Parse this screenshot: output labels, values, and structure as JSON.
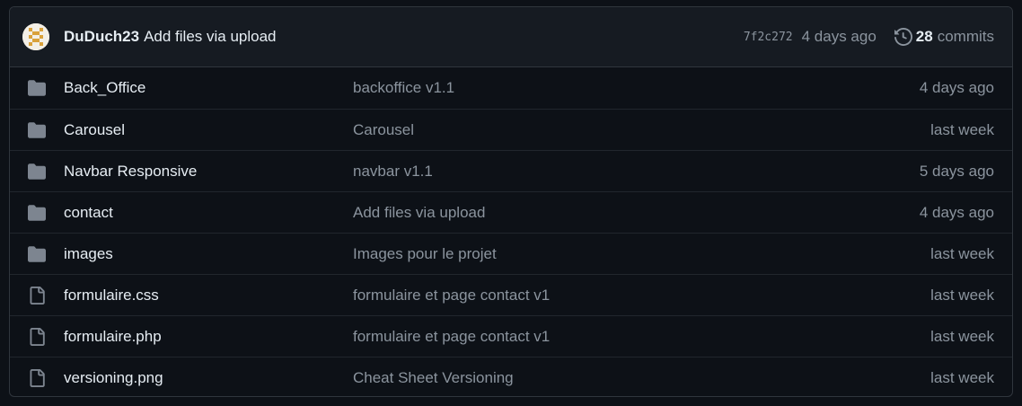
{
  "commit": {
    "author": "DuDuch23",
    "message": "Add files via upload",
    "sha": "7f2c272",
    "time": "4 days ago",
    "commit_count": "28",
    "commits_label": "commits"
  },
  "colors": {
    "background": "#0d1117",
    "header_bg": "#161b22",
    "border": "#30363d",
    "folder_icon": "#7d8590",
    "muted_text": "#8b949e"
  },
  "files": [
    {
      "type": "folder",
      "icon": "folder-icon",
      "name": "Back_Office",
      "message": "backoffice v1.1",
      "age": "4 days ago"
    },
    {
      "type": "folder",
      "icon": "folder-icon",
      "name": "Carousel",
      "message": "Carousel",
      "age": "last week"
    },
    {
      "type": "folder",
      "icon": "folder-icon",
      "name": "Navbar Responsive",
      "message": "navbar v1.1",
      "age": "5 days ago"
    },
    {
      "type": "folder",
      "icon": "folder-icon",
      "name": "contact",
      "message": "Add files via upload",
      "age": "4 days ago"
    },
    {
      "type": "folder",
      "icon": "folder-icon",
      "name": "images",
      "message": "Images pour le projet",
      "age": "last week"
    },
    {
      "type": "file",
      "icon": "file-icon",
      "name": "formulaire.css",
      "message": "formulaire et page contact v1",
      "age": "last week"
    },
    {
      "type": "file",
      "icon": "file-icon",
      "name": "formulaire.php",
      "message": "formulaire et page contact v1",
      "age": "last week"
    },
    {
      "type": "file",
      "icon": "file-icon",
      "name": "versioning.png",
      "message": "Cheat Sheet Versioning",
      "age": "last week"
    }
  ]
}
